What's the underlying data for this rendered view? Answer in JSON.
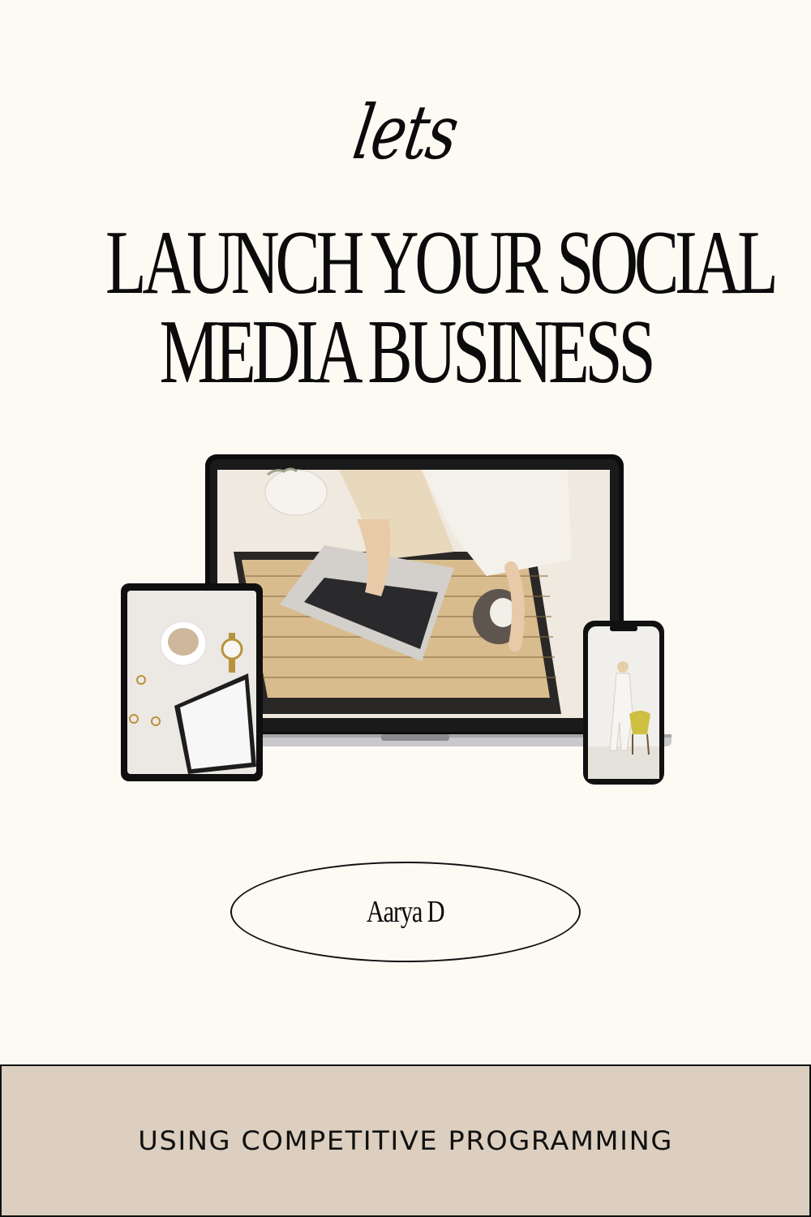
{
  "cover": {
    "script_word": "lets",
    "title_line1": "LAUNCH YOUR SOCIAL",
    "title_line2": "MEDIA BUSINESS",
    "author": "Aarya D",
    "subtitle": "USING COMPETITIVE PROGRAMMING"
  },
  "colors": {
    "background": "#fdf9f3",
    "footer_band": "#dccfbf",
    "text": "#0b0b0b"
  },
  "images": {
    "laptop_screen": "photo-hands-typing-on-laptop-with-coffee-cup",
    "tablet_screen": "photo-coffee-watch-notebook-flatlay",
    "phone_screen": "photo-woman-standing-with-phone-and-yellow-chair"
  }
}
